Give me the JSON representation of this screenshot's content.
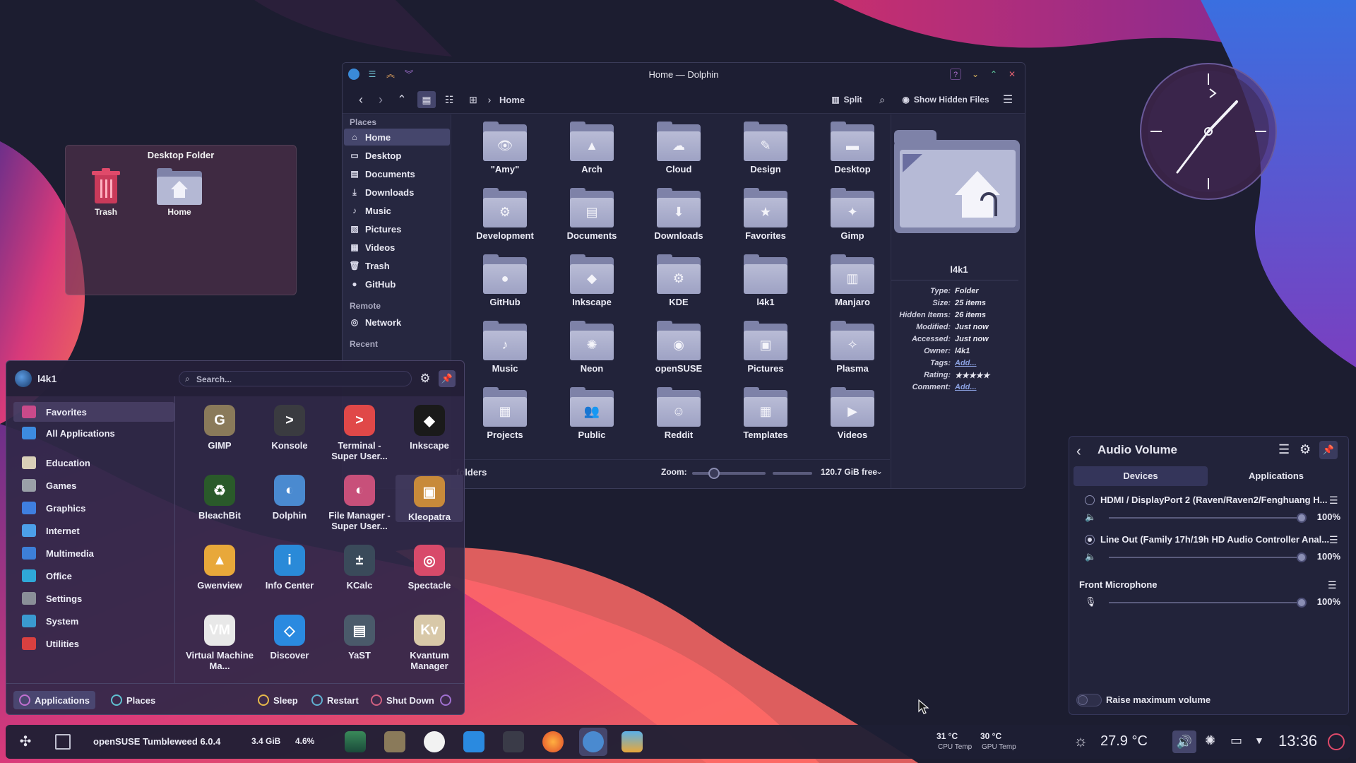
{
  "desktop": {
    "folder_title": "Desktop Folder",
    "icons": [
      {
        "label": "Trash",
        "icon": "trash-icon"
      },
      {
        "label": "Home",
        "icon": "home-folder-icon"
      }
    ]
  },
  "dolphin": {
    "title": "Home — Dolphin",
    "breadcrumb": "Home",
    "toolbar": {
      "split": "Split",
      "show_hidden": "Show Hidden Files"
    },
    "places_header": "Places",
    "places": [
      {
        "label": "Home",
        "icon": "home-icon",
        "active": true
      },
      {
        "label": "Desktop",
        "icon": "desktop-icon"
      },
      {
        "label": "Documents",
        "icon": "documents-icon"
      },
      {
        "label": "Downloads",
        "icon": "downloads-icon"
      },
      {
        "label": "Music",
        "icon": "music-icon"
      },
      {
        "label": "Pictures",
        "icon": "pictures-icon"
      },
      {
        "label": "Videos",
        "icon": "videos-icon"
      },
      {
        "label": "Trash",
        "icon": "trash-icon"
      },
      {
        "label": "GitHub",
        "icon": "github-icon"
      }
    ],
    "remote_header": "Remote",
    "remote": [
      {
        "label": "Network",
        "icon": "network-icon"
      }
    ],
    "recent_header": "Recent",
    "folders": [
      {
        "label": "\"Amy\"",
        "glyph": "👁"
      },
      {
        "label": "Arch",
        "glyph": "▲"
      },
      {
        "label": "Cloud",
        "glyph": "☁"
      },
      {
        "label": "Design",
        "glyph": "✎"
      },
      {
        "label": "Desktop",
        "glyph": "▬"
      },
      {
        "label": "Development",
        "glyph": "⚙"
      },
      {
        "label": "Documents",
        "glyph": "▤"
      },
      {
        "label": "Downloads",
        "glyph": "⬇"
      },
      {
        "label": "Favorites",
        "glyph": "★"
      },
      {
        "label": "Gimp",
        "glyph": "✦"
      },
      {
        "label": "GitHub",
        "glyph": "●"
      },
      {
        "label": "Inkscape",
        "glyph": "◆"
      },
      {
        "label": "KDE",
        "glyph": "⚙"
      },
      {
        "label": "l4k1",
        "glyph": ""
      },
      {
        "label": "Manjaro",
        "glyph": "▥"
      },
      {
        "label": "Music",
        "glyph": "♪"
      },
      {
        "label": "Neon",
        "glyph": "✺"
      },
      {
        "label": "openSUSE",
        "glyph": "◉"
      },
      {
        "label": "Pictures",
        "glyph": "▣"
      },
      {
        "label": "Plasma",
        "glyph": "✧"
      },
      {
        "label": "Projects",
        "glyph": "▦"
      },
      {
        "label": "Public",
        "glyph": "👥"
      },
      {
        "label": "Reddit",
        "glyph": "☺"
      },
      {
        "label": "Templates",
        "glyph": "▦"
      },
      {
        "label": "Videos",
        "glyph": "▶"
      }
    ],
    "status_left": "folders",
    "zoom_label": "Zoom:",
    "zoom_level": 0.3,
    "free_space": "120.7 GiB free",
    "info": {
      "name": "l4k1",
      "rows": [
        {
          "k": "Type:",
          "v": "Folder"
        },
        {
          "k": "Size:",
          "v": "25 items"
        },
        {
          "k": "Hidden Items:",
          "v": "26 items"
        },
        {
          "k": "Modified:",
          "v": "Just now"
        },
        {
          "k": "Accessed:",
          "v": "Just now"
        },
        {
          "k": "Owner:",
          "v": "l4k1"
        },
        {
          "k": "Tags:",
          "v": "Add..."
        },
        {
          "k": "Rating:",
          "v": "★★★★★"
        },
        {
          "k": "Comment:",
          "v": "Add..."
        }
      ]
    }
  },
  "launcher": {
    "user": "l4k1",
    "search_placeholder": "Search...",
    "categories": [
      {
        "label": "Favorites",
        "color": "#c94a8a",
        "active": true
      },
      {
        "label": "All Applications",
        "color": "#3d8be0"
      },
      {
        "label": "Education",
        "color": "#d9cfb8"
      },
      {
        "label": "Games",
        "color": "#9aa0a8"
      },
      {
        "label": "Graphics",
        "color": "#3f7fe0"
      },
      {
        "label": "Internet",
        "color": "#4c9fe8"
      },
      {
        "label": "Multimedia",
        "color": "#3d7fd8"
      },
      {
        "label": "Office",
        "color": "#2fa8d8"
      },
      {
        "label": "Settings",
        "color": "#8a8f98"
      },
      {
        "label": "System",
        "color": "#3a9ad0"
      },
      {
        "label": "Utilities",
        "color": "#d94040"
      }
    ],
    "apps": [
      {
        "label": "GIMP",
        "color": "#8a7a5a",
        "glyph": "G"
      },
      {
        "label": "Konsole",
        "color": "#3a3b40",
        "glyph": ">"
      },
      {
        "label": "Terminal - Super User...",
        "color": "#e04848",
        "glyph": ">"
      },
      {
        "label": "Inkscape",
        "color": "#1a1a1a",
        "glyph": "◆"
      },
      {
        "label": "BleachBit",
        "color": "#2a5a2a",
        "glyph": "♻"
      },
      {
        "label": "Dolphin",
        "color": "#4a8ad0",
        "glyph": "◐"
      },
      {
        "label": "File Manager - Super User...",
        "color": "#c8507a",
        "glyph": "◐"
      },
      {
        "label": "Kleopatra",
        "color": "#c88a3a",
        "glyph": "▣"
      },
      {
        "label": "Gwenview",
        "color": "#e8a83a",
        "glyph": "▲"
      },
      {
        "label": "Info Center",
        "color": "#2a8ad8",
        "glyph": "i"
      },
      {
        "label": "KCalc",
        "color": "#3a4a5a",
        "glyph": "±"
      },
      {
        "label": "Spectacle",
        "color": "#d84a6a",
        "glyph": "◎"
      },
      {
        "label": "Virtual Machine Ma...",
        "color": "#e8e8e8",
        "glyph": "VM"
      },
      {
        "label": "Discover",
        "color": "#2a8ae0",
        "glyph": "◇"
      },
      {
        "label": "YaST",
        "color": "#4a5a6a",
        "glyph": "▤"
      },
      {
        "label": "Kvantum Manager",
        "color": "#d8c8a8",
        "glyph": "Kv"
      }
    ],
    "footer": {
      "applications": "Applications",
      "places": "Places",
      "sleep": "Sleep",
      "restart": "Restart",
      "shutdown": "Shut Down"
    }
  },
  "audio": {
    "title": "Audio Volume",
    "tabs": [
      "Devices",
      "Applications"
    ],
    "devices": [
      {
        "name": "HDMI / DisplayPort 2 (Raven/Raven2/Fenghuang H...",
        "volume": "100%",
        "level": 1.0,
        "selected": false
      },
      {
        "name": "Line Out (Family 17h/19h HD Audio Controller Anal...",
        "volume": "100%",
        "level": 1.0,
        "selected": true
      }
    ],
    "mic": {
      "name": "Front Microphone",
      "volume": "100%",
      "level": 1.0
    },
    "raise_max": "Raise maximum volume"
  },
  "taskbar": {
    "distro": "openSUSE Tumbleweed 6.0.4",
    "mem": "3.4 GiB",
    "cpu": "4.6%",
    "cpu_temp": "31 °C",
    "cpu_temp_label": "CPU Temp",
    "gpu_temp": "30 °C",
    "gpu_temp_label": "GPU Temp",
    "weather": "27.9 °C",
    "time": "13:36"
  }
}
